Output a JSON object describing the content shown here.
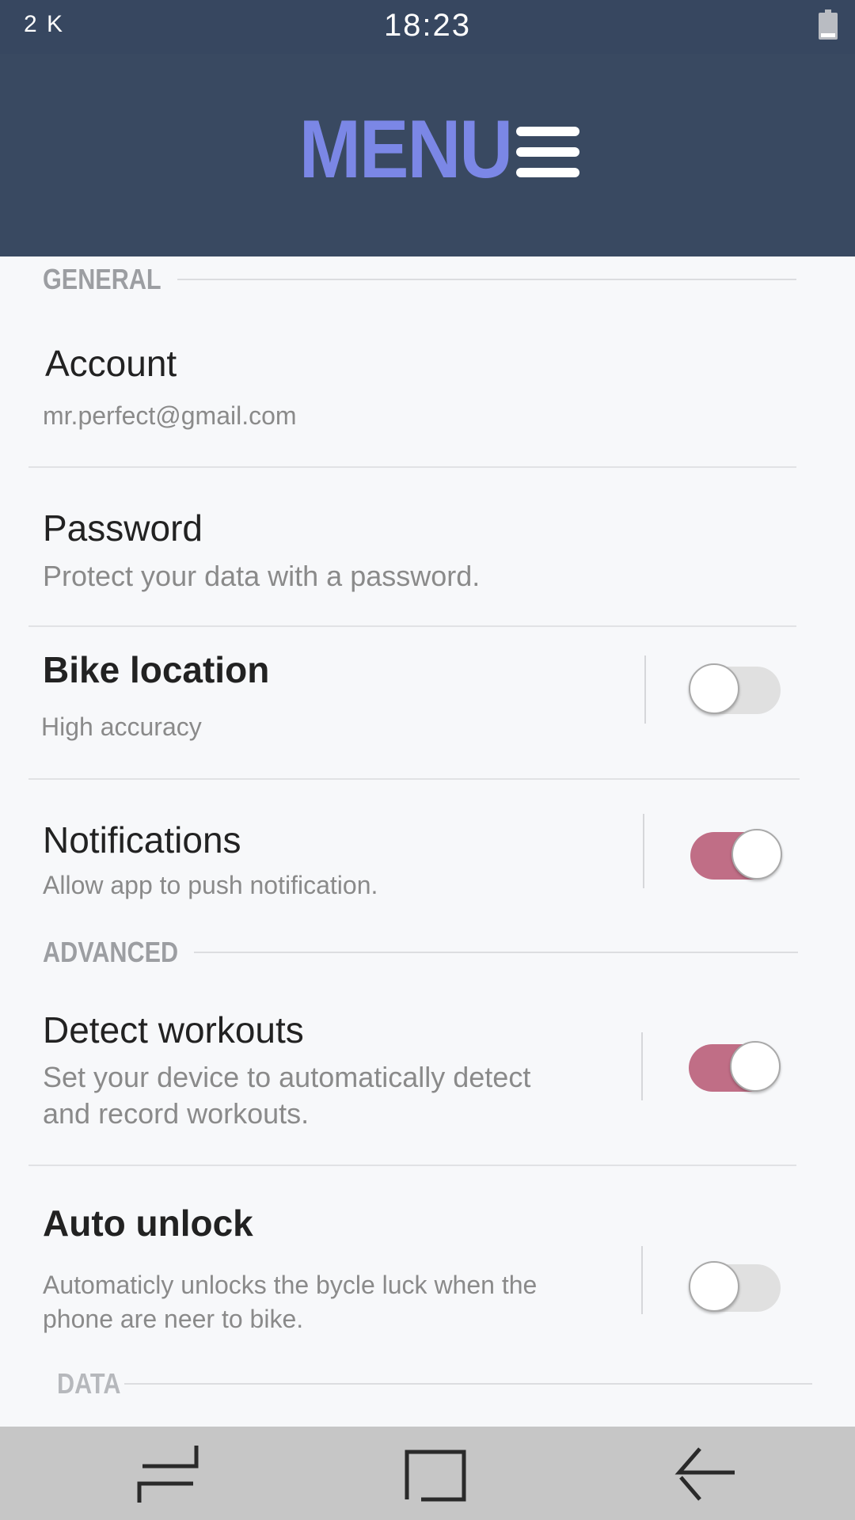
{
  "status_bar": {
    "left_text": "2 K",
    "time": "18:23",
    "battery_icon": "battery-icon"
  },
  "header": {
    "title": "MENU",
    "menu_icon": "hamburger-icon"
  },
  "sections": {
    "general": "GENERAL",
    "advanced": "ADVANCED",
    "data": "DATA"
  },
  "items": {
    "account": {
      "title": "Account",
      "subtitle": "mr.perfect@gmail.com"
    },
    "password": {
      "title": "Password",
      "subtitle": "Protect your data with a password."
    },
    "bike_location": {
      "title": "Bike location",
      "subtitle": "High accuracy",
      "enabled": false
    },
    "notifications": {
      "title": "Notifications",
      "subtitle": "Allow app to push notification.",
      "enabled": true
    },
    "detect_workouts": {
      "title": "Detect workouts",
      "subtitle_line1": "Set your device to automatically detect",
      "subtitle_line2": "and record workouts.",
      "enabled": true
    },
    "auto_unlock": {
      "title": "Auto unlock",
      "subtitle_line1": "Automaticly unlocks the bycle luck when the",
      "subtitle_line2": "phone are neer to bike.",
      "enabled": false
    }
  },
  "nav_bar": {
    "icons": [
      "recents-icon",
      "home-icon",
      "back-icon"
    ]
  },
  "colors": {
    "header_bg": "#394961",
    "menu_title": "#7b87e6",
    "toggle_on": "#c06e86",
    "toggle_off": "#e0e0e0",
    "nav_bg": "#c6c6c6"
  }
}
